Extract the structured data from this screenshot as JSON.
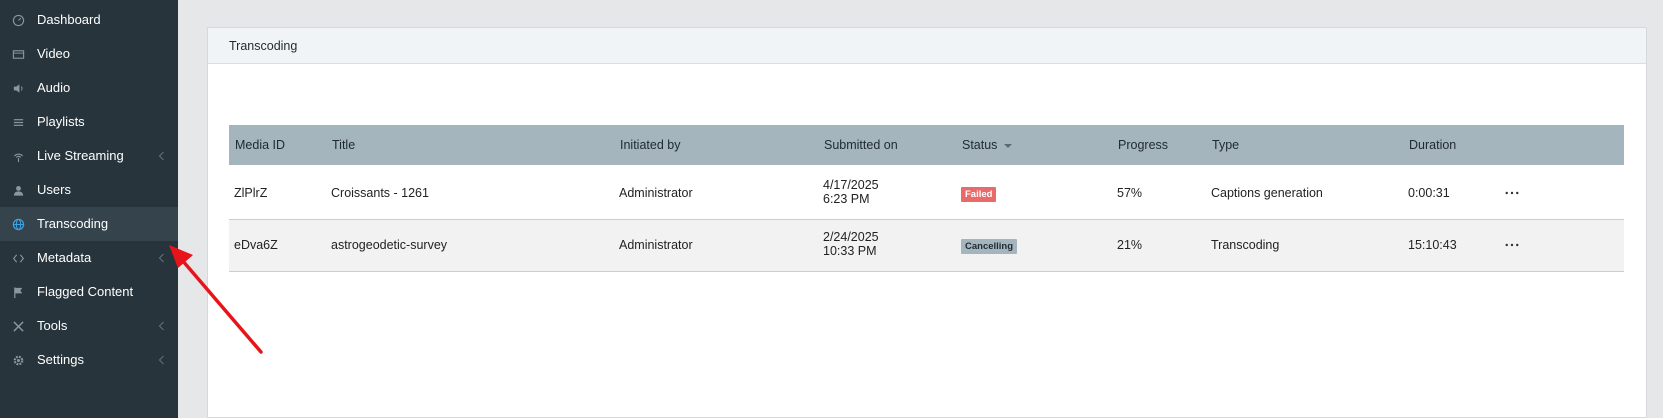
{
  "sidebar": {
    "items": [
      {
        "label": "Dashboard",
        "icon": "dashboard-icon",
        "has_chevron": false,
        "active": false
      },
      {
        "label": "Video",
        "icon": "film-icon",
        "has_chevron": false,
        "active": false
      },
      {
        "label": "Audio",
        "icon": "speaker-icon",
        "has_chevron": false,
        "active": false
      },
      {
        "label": "Playlists",
        "icon": "list-icon",
        "has_chevron": false,
        "active": false
      },
      {
        "label": "Live Streaming",
        "icon": "broadcast-icon",
        "has_chevron": true,
        "active": false
      },
      {
        "label": "Users",
        "icon": "user-icon",
        "has_chevron": false,
        "active": false
      },
      {
        "label": "Transcoding",
        "icon": "globe-icon",
        "has_chevron": false,
        "active": true
      },
      {
        "label": "Metadata",
        "icon": "code-icon",
        "has_chevron": true,
        "active": false
      },
      {
        "label": "Flagged Content",
        "icon": "flag-icon",
        "has_chevron": false,
        "active": false
      },
      {
        "label": "Tools",
        "icon": "tools-icon",
        "has_chevron": true,
        "active": false
      },
      {
        "label": "Settings",
        "icon": "gear-icon",
        "has_chevron": true,
        "active": false
      }
    ]
  },
  "panel": {
    "title": "Transcoding"
  },
  "table": {
    "columns": [
      "Media ID",
      "Title",
      "Initiated by",
      "Submitted on",
      "Status",
      "Progress",
      "Type",
      "Duration"
    ],
    "sorted_column": "Status",
    "rows": [
      {
        "media_id": "ZlPlrZ",
        "title": "Croissants - 1261",
        "initiated_by": "Administrator",
        "submitted_date": "4/17/2025",
        "submitted_time": "6:23 PM",
        "status": "Failed",
        "progress": "57%",
        "type": "Captions generation",
        "duration": "0:00:31"
      },
      {
        "media_id": "eDva6Z",
        "title": "astrogeodetic-survey",
        "initiated_by": "Administrator",
        "submitted_date": "2/24/2025",
        "submitted_time": "10:33 PM",
        "status": "Cancelling",
        "progress": "21%",
        "type": "Transcoding",
        "duration": "15:10:43"
      }
    ]
  },
  "colors": {
    "sidebar_bg": "#27343b",
    "active_icon": "#3aa3e3",
    "header_bg": "#a4b5be",
    "failed_badge": "#e86a6a",
    "annotation_arrow": "#e8141c"
  }
}
